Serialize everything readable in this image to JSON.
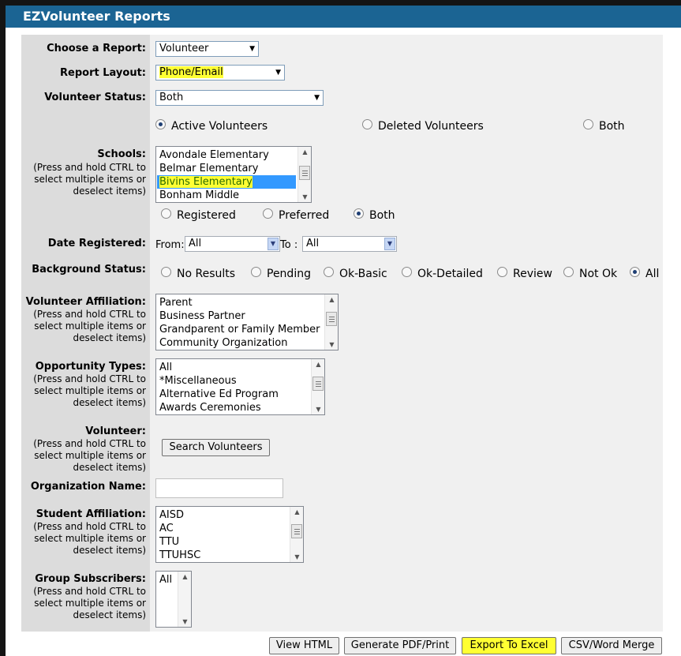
{
  "app": {
    "title": "EZVolunteer Reports"
  },
  "report": {
    "choose_label": "Choose a Report:",
    "choose_value": "Volunteer",
    "layout_label": "Report Layout:",
    "layout_value": "Phone/Email",
    "status_label": "Volunteer Status:",
    "status_value": "Both"
  },
  "volunteer_radios": [
    "Active Volunteers",
    "Deleted Volunteers",
    "Both"
  ],
  "schools": {
    "label": "Schools:",
    "hint": "(Press and hold CTRL to select multiple items or deselect items)",
    "items": [
      "Avondale Elementary",
      "Belmar Elementary",
      "Bivins Elementary",
      "Bonham Middle"
    ],
    "selected": "Bivins Elementary",
    "radios": [
      "Registered",
      "Preferred",
      "Both"
    ]
  },
  "date": {
    "label": "Date Registered:",
    "from_label": "From:",
    "from_value": "All",
    "to_label": "To :",
    "to_value": "All"
  },
  "background": {
    "label": "Background Status:",
    "options": [
      "No Results",
      "Pending",
      "Ok-Basic",
      "Ok-Detailed",
      "Review",
      "Not Ok",
      "All"
    ],
    "selected": "All"
  },
  "affiliation": {
    "label": "Volunteer Affiliation:",
    "hint": "(Press and hold CTRL to select multiple items or deselect items)",
    "items": [
      "Parent",
      "Business Partner",
      "Grandparent or Family Member",
      "Community Organization"
    ]
  },
  "opportunity": {
    "label": "Opportunity Types:",
    "hint": "(Press and hold CTRL to select multiple items or deselect items)",
    "items": [
      "All",
      "*Miscellaneous",
      "Alternative Ed Program",
      "Awards Ceremonies"
    ]
  },
  "volunteer": {
    "label": "Volunteer:",
    "hint": "(Press and hold CTRL to select multiple items or deselect items)",
    "search_button": "Search Volunteers"
  },
  "organization": {
    "label": "Organization Name:",
    "value": ""
  },
  "student": {
    "label": "Student Affiliation:",
    "hint": "(Press and hold CTRL to select multiple items or deselect items)",
    "items": [
      "AISD",
      "AC",
      "TTU",
      "TTUHSC"
    ]
  },
  "group": {
    "label": "Group Subscribers:",
    "hint": "(Press and hold CTRL to select multiple items or deselect items)",
    "items": [
      "All"
    ]
  },
  "actions": {
    "view_html": "View HTML",
    "pdf": "Generate PDF/Print",
    "excel": "Export To Excel",
    "csv": "CSV/Word Merge"
  },
  "colors": {
    "title_bar": "#1b6493",
    "highlight": "#ffff33",
    "selection": "#3399ff"
  }
}
